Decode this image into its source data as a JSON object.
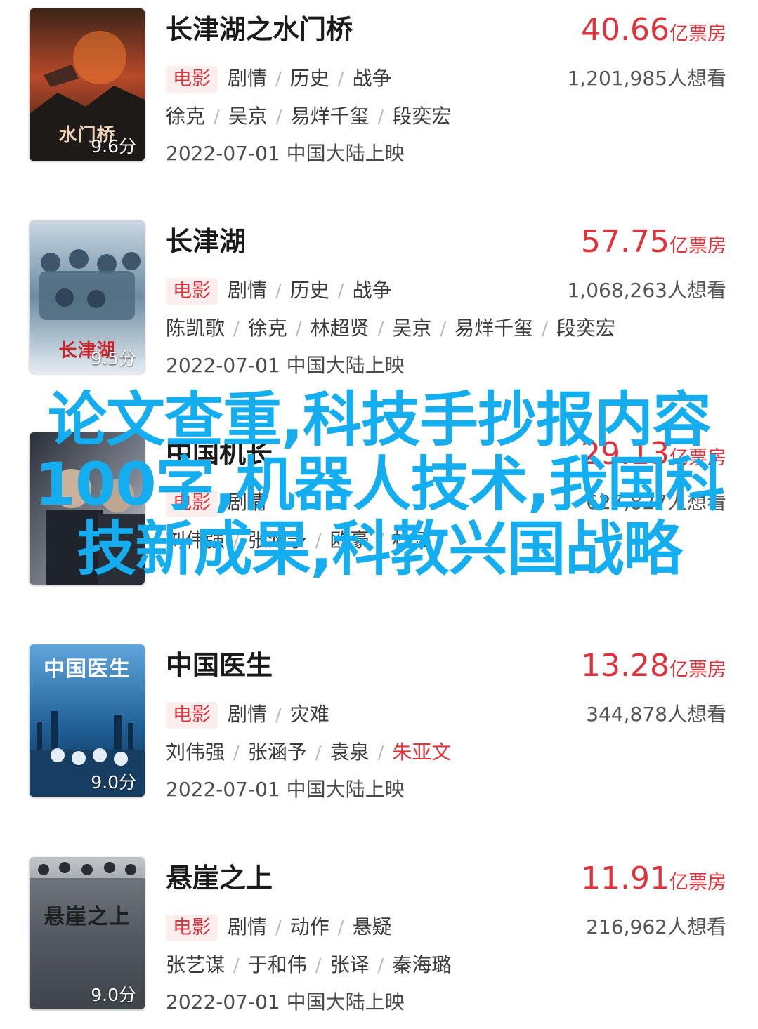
{
  "movies": [
    {
      "title": "长津湖之水门桥",
      "box_office_value": "40.66",
      "box_office_unit": "亿票房",
      "type": "电影",
      "genres": [
        "剧情",
        "历史",
        "战争"
      ],
      "wish_count": "1,201,985人想看",
      "cast": [
        "徐克",
        "吴京",
        "易烊千玺",
        "段奕宏"
      ],
      "release": "2022-07-01 中国大陆上映",
      "score": "9.6分",
      "poster_text": "水门桥",
      "poster_colors": [
        "#5a2a1a",
        "#c2452a",
        "#1c1a1a"
      ]
    },
    {
      "title": "长津湖",
      "box_office_value": "57.75",
      "box_office_unit": "亿票房",
      "type": "电影",
      "genres": [
        "剧情",
        "历史",
        "战争"
      ],
      "wish_count": "1,068,263人想看",
      "cast": [
        "陈凯歌",
        "徐克",
        "林超贤",
        "吴京",
        "易烊千玺",
        "段奕宏"
      ],
      "release": "2022-07-01 中国大陆上映",
      "score": "9.5分",
      "poster_text": "长津湖",
      "poster_colors": [
        "#9ab6cc",
        "#4d6e86",
        "#d8e3ec"
      ]
    },
    {
      "title": "中国机长",
      "box_office_value": "29.13",
      "box_office_unit": "亿票房",
      "type": "电影",
      "genres": [
        "剧情"
      ],
      "wish_count": "627,827人想看",
      "cast": [
        "刘伟强",
        "张涵予",
        "欧豪",
        "杜江"
      ],
      "release": "",
      "score": "",
      "poster_text": "",
      "poster_colors": [
        "#2b2f3a",
        "#8a8f99",
        "#d9dbe0"
      ]
    },
    {
      "title": "中国医生",
      "box_office_value": "13.28",
      "box_office_unit": "亿票房",
      "type": "电影",
      "genres": [
        "剧情",
        "灾难"
      ],
      "wish_count": "344,878人想看",
      "cast": [
        "刘伟强",
        "张涵予",
        "袁泉",
        "朱亚文"
      ],
      "release": "2022-07-01 中国大陆上映",
      "score": "9.0分",
      "poster_text": "中国医生",
      "poster_colors": [
        "#1d5a8e",
        "#3f8bc4",
        "#0e2d4a"
      ]
    },
    {
      "title": "悬崖之上",
      "box_office_value": "11.91",
      "box_office_unit": "亿票房",
      "type": "电影",
      "genres": [
        "剧情",
        "动作",
        "悬疑"
      ],
      "wish_count": "216,962人想看",
      "cast": [
        "张艺谋",
        "于和伟",
        "张译",
        "秦海璐"
      ],
      "release": "2022-07-01 中国大陆上映",
      "score": "9.0分",
      "poster_text": "悬崖之上",
      "poster_colors": [
        "#3a3f45",
        "#6f757c",
        "#b9bec4"
      ]
    }
  ],
  "overlay_text": "论文查重,科技手抄报内容100字,机器人技术,我国科技新成果,科教兴国战略",
  "accent_color": "#e0323a",
  "overlay_color": "#14aef0"
}
